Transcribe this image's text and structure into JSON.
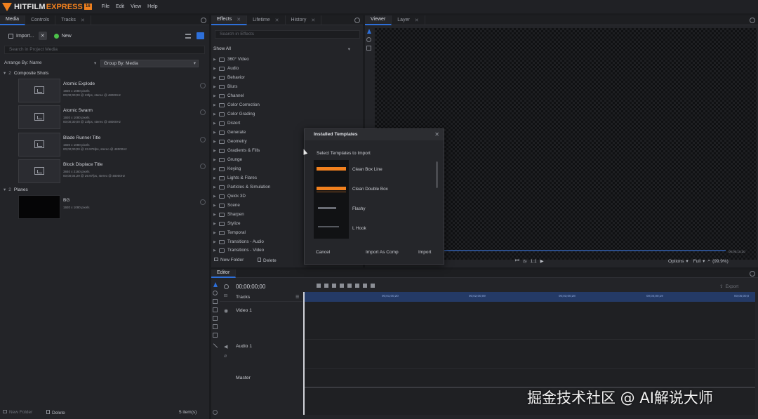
{
  "app": {
    "logo_main": "HITFILM",
    "logo_sub": "EXPRESS",
    "logo_ver": "16",
    "menu": [
      "File",
      "Edit",
      "View",
      "Help"
    ]
  },
  "media_panel": {
    "tabs": [
      "Media",
      "Controls",
      "Tracks"
    ],
    "import_label": "Import...",
    "new_label": "New",
    "search_placeholder": "Search in Project Media",
    "arrange_label": "Arrange By: Name",
    "group_label": "Group By: Media",
    "section_composite": "Composite Shots",
    "section_composite_count": "2",
    "items": [
      {
        "title": "Atomic Explode",
        "meta1": "1920 x 1080 pixels",
        "meta2": "00;00;00;00 @ 23fps, stereo @ 48000Hz"
      },
      {
        "title": "Atomic Swarm",
        "meta1": "1920 x 1080 pixels",
        "meta2": "00;00;30;00 @ 23fps, stereo @ 48000Hz"
      },
      {
        "title": "Blade Runner Title",
        "meta1": "1920 x 1080 pixels",
        "meta2": "00;00;00;00 @ 23.976fps, stereo @ 48000Hz"
      },
      {
        "title": "Block Displace Title",
        "meta1": "3840 x 2160 pixels",
        "meta2": "00;00;04;29 @ 29.97fps, stereo @ 48000Hz"
      }
    ],
    "section_planes": "Planes",
    "section_planes_count": "2",
    "plane": {
      "title": "BG",
      "meta1": "1920 x 1080 pixels"
    },
    "footer_new_folder": "New Folder",
    "footer_delete": "Delete",
    "footer_count": "5 item(s)"
  },
  "effects_panel": {
    "tabs": [
      "Effects",
      "Lifetime",
      "History"
    ],
    "search_placeholder": "Search in Effects",
    "show_all": "Show All",
    "folders": [
      "360° Video",
      "Audio",
      "Behavior",
      "Blurs",
      "Channel",
      "Color Correction",
      "Color Grading",
      "Distort",
      "Generate",
      "Geometry",
      "Gradients & Fills",
      "Grunge",
      "Keying",
      "Lights & Flares",
      "Particles & Simulation",
      "Quick 3D",
      "Scene",
      "Sharpen",
      "Stylize",
      "Temporal",
      "Transitions - Audio",
      "Transitions - Video"
    ],
    "footer_new_folder": "New Folder",
    "footer_delete": "Delete"
  },
  "dialog": {
    "title": "Installed Templates",
    "subtitle": "Select Templates to Import",
    "templates": [
      "Clean Box Line",
      "Clean Double Box",
      "Flashy",
      "L Hook"
    ],
    "cancel": "Cancel",
    "import_comp": "Import As Comp",
    "import": "Import"
  },
  "viewer": {
    "tabs": [
      "Viewer",
      "Layer"
    ],
    "timecode": "00;00;10;20",
    "options": "Options",
    "full": "Full",
    "zoom": "(99.9%)",
    "frame_label": "1:1"
  },
  "editor": {
    "tab": "Editor",
    "timecode": "00;00;00;00",
    "tracks_label": "Tracks",
    "video_track": "Video 1",
    "audio_track": "Audio 1",
    "master": "Master",
    "export": "Export",
    "markers": [
      "00;01;00;20",
      "00;02;00;09",
      "00;03;00;28",
      "00;04;00;19",
      "00;05;00;0"
    ]
  },
  "watermark": "掘金技术社区 @ AI解说大师",
  "colors": {
    "accent_blue": "#2d6fd9",
    "brand_orange": "#f0801e",
    "new_green": "#4cc24a"
  }
}
